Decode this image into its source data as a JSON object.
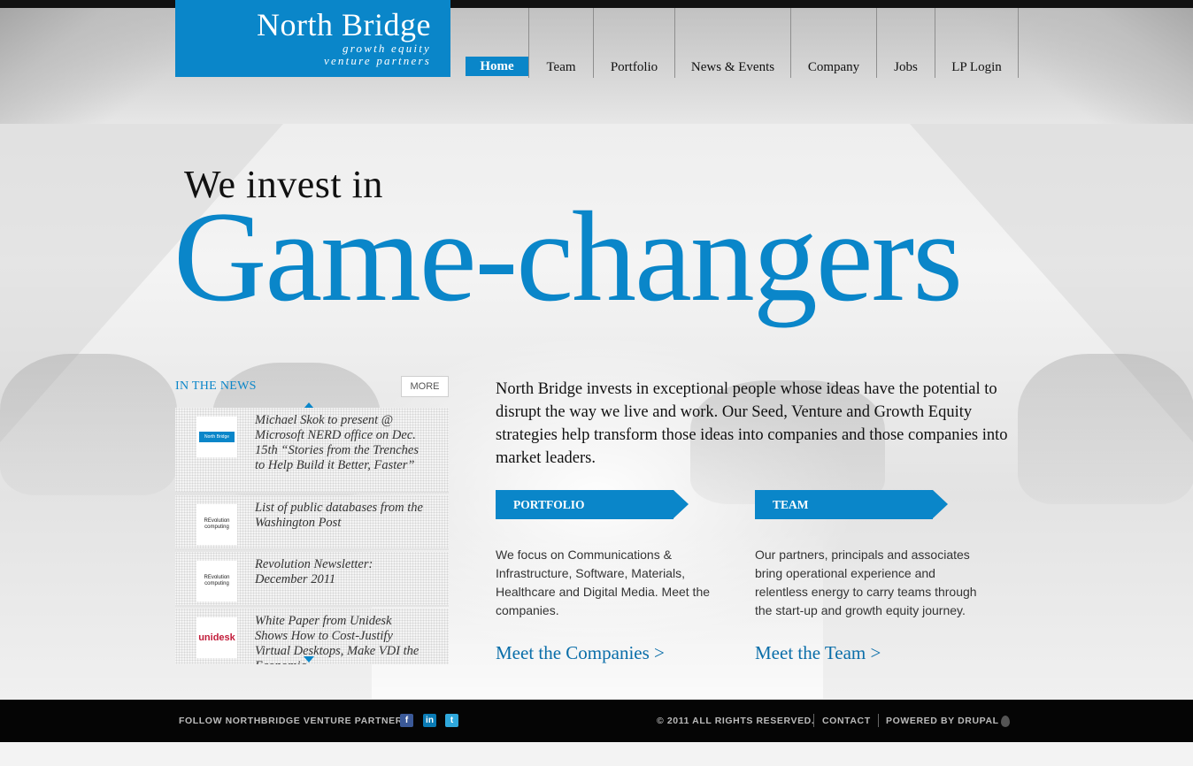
{
  "logo": {
    "name": "North Bridge",
    "tagline_1": "growth equity",
    "tagline_2": "venture partners"
  },
  "nav": {
    "items": [
      {
        "label": "Home",
        "active": true
      },
      {
        "label": "Team",
        "active": false
      },
      {
        "label": "Portfolio",
        "active": false
      },
      {
        "label": "News & Events",
        "active": false
      },
      {
        "label": "Company",
        "active": false
      },
      {
        "label": "Jobs",
        "active": false
      },
      {
        "label": "LP Login",
        "active": false
      }
    ]
  },
  "hero": {
    "line1": "We invest in",
    "line2": "Game-changers"
  },
  "news": {
    "title": "IN THE NEWS",
    "more_label": "MORE",
    "items": [
      {
        "thumb": "North Bridge",
        "text": "Michael Skok to present @ Microsoft NERD office on Dec. 15th “Stories from the Trenches to Help Build it Better, Faster”"
      },
      {
        "thumb": "REvolution computing",
        "text": "List of public databases from the Washington Post"
      },
      {
        "thumb": "REvolution computing",
        "text": "Revolution Newsletter: December 2011"
      },
      {
        "thumb": "unidesk",
        "text": "White Paper from Unidesk Shows How to Cost-Justify Virtual Desktops, Make VDI the Economic ..."
      }
    ]
  },
  "intro": {
    "text": "North Bridge invests in exceptional people whose ideas have the potential to disrupt the way we live and work. Our Seed, Venture and Growth Equity strategies help transform those ideas into companies and those companies into market leaders."
  },
  "portfolio": {
    "heading": "PORTFOLIO",
    "text": "We focus on Communications & Infrastructure, Software, Materials, Healthcare and Digital Media. Meet the companies.",
    "link": "Meet the Companies >"
  },
  "team": {
    "heading": "TEAM",
    "text": "Our partners, principals and associates bring operational experience and relentless energy to carry teams through the start-up and growth equity journey.",
    "link": "Meet the Team >"
  },
  "footer": {
    "follow": "FOLLOW NORTHBRIDGE VENTURE PARTNERS",
    "copyright": "© 2011 ALL RIGHTS RESERVED.",
    "contact": "CONTACT",
    "powered": "POWERED BY DRUPAL"
  },
  "colors": {
    "brand_blue": "#0a86c9",
    "footer_bg": "#050505"
  },
  "icons": [
    "facebook-icon",
    "linkedin-icon",
    "twitter-icon",
    "drupal-icon",
    "scroll-up-icon",
    "scroll-down-icon"
  ]
}
